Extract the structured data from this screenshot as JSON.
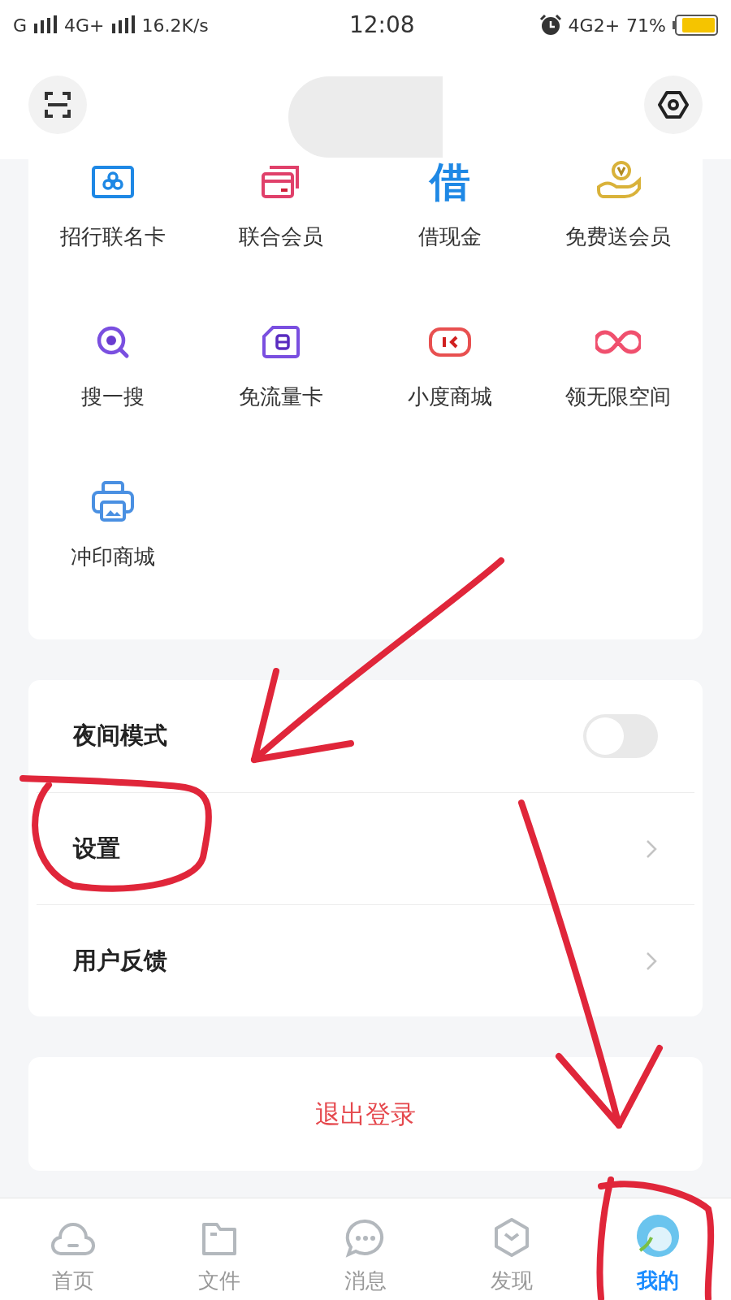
{
  "status_bar": {
    "carrier": "G",
    "network": "4G+",
    "speed": "16.2K/s",
    "time": "12:08",
    "network_right": "4G2+",
    "battery": "71%"
  },
  "services": [
    {
      "label": "招行联名卡"
    },
    {
      "label": "联合会员"
    },
    {
      "label": "借现金",
      "glyph": "借"
    },
    {
      "label": "免费送会员"
    },
    {
      "label": "搜一搜"
    },
    {
      "label": "免流量卡"
    },
    {
      "label": "小度商城"
    },
    {
      "label": "领无限空间"
    },
    {
      "label": "冲印商城"
    }
  ],
  "settings": [
    {
      "label": "夜间模式",
      "kind": "toggle",
      "on": false
    },
    {
      "label": "设置",
      "kind": "link"
    },
    {
      "label": "用户反馈",
      "kind": "link"
    }
  ],
  "logout": "退出登录",
  "tabs": [
    {
      "label": "首页",
      "selected": false
    },
    {
      "label": "文件",
      "selected": false
    },
    {
      "label": "消息",
      "selected": false
    },
    {
      "label": "发现",
      "selected": false
    },
    {
      "label": "我的",
      "selected": true
    }
  ],
  "annotations": [
    {
      "kind": "arrow"
    },
    {
      "kind": "circle"
    },
    {
      "kind": "arrow"
    },
    {
      "kind": "circle"
    }
  ]
}
